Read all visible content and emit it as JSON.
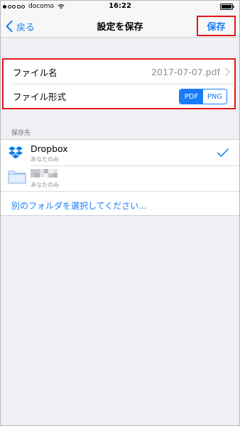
{
  "status_bar": {
    "carrier": "docomo",
    "time": "16:22",
    "signal_bars_filled": 1,
    "signal_bars_total": 5
  },
  "nav": {
    "back_label": "戻る",
    "title": "設定を保存",
    "save_label": "保存"
  },
  "settings": {
    "filename_label": "ファイル名",
    "filename_value": "2017-07-07.pdf",
    "format_label": "ファイル形式",
    "format_options": [
      "PDF",
      "PNG"
    ],
    "format_selected": "PDF"
  },
  "destination": {
    "section_title": "保存先",
    "items": [
      {
        "name": "Dropbox",
        "sub": "あなたのみ",
        "icon": "dropbox-icon",
        "selected": true
      },
      {
        "name": "",
        "sub": "あなたのみ",
        "icon": "folder-icon",
        "selected": false
      }
    ],
    "choose_other": "別のフォルダを選択してください..."
  },
  "colors": {
    "accent": "#1a7cf5",
    "highlight_border": "#e0181b",
    "background": "#efeff4"
  }
}
